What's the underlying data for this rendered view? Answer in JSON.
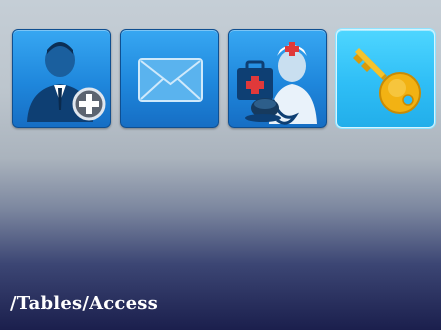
{
  "menu": {
    "tiles": [
      {
        "icon": "add-user-icon",
        "selected": false
      },
      {
        "icon": "envelope-icon",
        "selected": false
      },
      {
        "icon": "nurse-medical-icon",
        "selected": false
      },
      {
        "icon": "key-icon",
        "selected": true
      }
    ]
  },
  "status": {
    "path": "/Tables/Access"
  },
  "colors": {
    "tile": "#1f87dc",
    "tile_selected": "#2fbef6",
    "key": "#f2b213"
  }
}
